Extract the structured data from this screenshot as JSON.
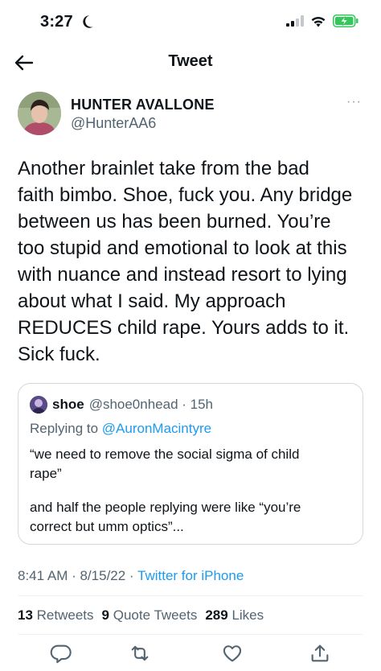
{
  "status_bar": {
    "time": "3:27"
  },
  "nav": {
    "title": "Tweet"
  },
  "author": {
    "name": "HUNTER AVALLONE",
    "handle": "@HunterAA6",
    "more": "···"
  },
  "tweet": {
    "lines": [
      "Another brainlet take from the bad",
      "faith bimbo. Shoe, fuck you. Any bridge",
      "between us has been burned. You’re",
      "too stupid and emotional to look at this",
      "with nuance and instead resort to lying",
      "about what I said. My approach",
      "REDUCES child rape. Yours adds to it.",
      "Sick fuck."
    ]
  },
  "quoted": {
    "name": "shoe",
    "meta": "@shoe0nhead · 15h",
    "replying_prefix": "Replying to ",
    "replying_handle": "@AuronMacintyre",
    "lines": [
      "“we need to remove the social sigma of child",
      "rape”",
      "and half the people replying were like “you’re",
      "correct but umm optics”..."
    ]
  },
  "meta": {
    "time_date": "8:41 AM · 8/15/22 · ",
    "source": "Twitter for iPhone"
  },
  "stats": {
    "retweets_count": "13",
    "retweets_label": "Retweets",
    "quotes_count": "9",
    "quotes_label": "Quote Tweets",
    "likes_count": "289",
    "likes_label": "Likes"
  },
  "colors": {
    "accent": "#1d9bf0",
    "secondary_text": "#536471",
    "border": "#cfd9de",
    "battery": "#34c759"
  },
  "icons": [
    "moon-icon",
    "signal-icon",
    "wifi-icon",
    "battery-charging-icon",
    "back-arrow-icon",
    "reply-icon",
    "retweet-icon",
    "like-icon",
    "share-icon"
  ]
}
